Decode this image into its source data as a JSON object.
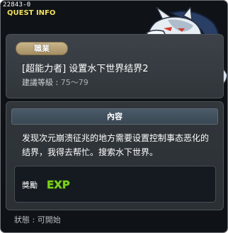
{
  "quest": {
    "id_text": "22843-0",
    "header_label": "QUEST INFO",
    "job_tab_label": "職業",
    "title": "[超能力者] 设置水下世界结界2",
    "level_label": "建議等級 : ",
    "level_value": "75～79",
    "content_label": "內容",
    "description": "发现次元崩溃征兆的地方需要设置控制事态恶化的结界，我得去帮忙。搜索水下世界。",
    "reward_label": "獎勵",
    "reward_exp_text": "EXP",
    "status_label": "狀態 : ",
    "status_value": "可開始"
  },
  "colors": {
    "window_bg": "#0f1318",
    "header_text": "#f4e25f",
    "job_tab": "#b9a477",
    "exp_green": "#7dd21e",
    "npc_wolf": "#3c5a8a"
  },
  "icons": {
    "npc": "wolf-npc-portrait",
    "reward": "exp-icon"
  }
}
